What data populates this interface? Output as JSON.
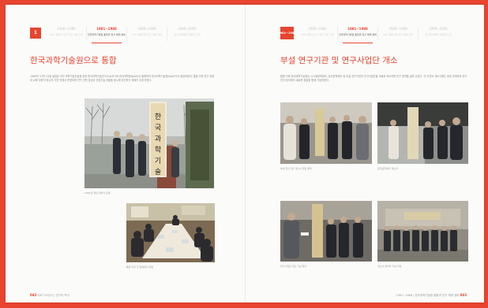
{
  "left_page": {
    "chapter_badge": "1",
    "tabs": [
      {
        "years": "1966~1980",
        "caption": "KIST 설립과 초기 연구 기반 구축"
      },
      {
        "years": "1981~1988",
        "caption": "한국과학기술원 통합과 연구 체제 정비"
      },
      {
        "years": "1989~1998",
        "caption": "KIST 재분리와 연구 역량 강화"
      },
      {
        "years": "1999~2005",
        "caption": "연구회 체제와 새로운 도약"
      }
    ],
    "active_tab": 1,
    "title": "한국과학기술원으로 통합",
    "body": "1980년 12월 23일 설립된 국가 과학기술진흥을 위한 한국과학기술연구소(KIST)와 한국과학원(KAIS)이 통합하여 한국과학기술원(KAIST)이 출범하였다. 통합 이후 연구 부문과 교육 부문이 하나의 기관 안에서 운영되며 연구 인력 양성과 산업기술 개발을 동시에 추진하는 체제가 갖추어졌다.",
    "photo_captions": [
      "1981년 현판 제막식 장면",
      "통합 이후 첫 운영회의 장면"
    ],
    "signboard_text": "한국과학기술원",
    "footer_page": "042",
    "footer_text": "KIST 50년사 | 연구의 역사"
  },
  "right_page": {
    "chapter_badge": "1981~1988",
    "tabs": [
      {
        "years": "1966~1980",
        "caption": "KIST 설립과 초기 연구 기반 구축"
      },
      {
        "years": "1981~1988",
        "caption": "한국과학기술원 통합과 연구 체제 정비"
      },
      {
        "years": "1989~1998",
        "caption": "KIST 재분리와 연구 역량 강화"
      },
      {
        "years": "1999~2005",
        "caption": "연구회 체제와 새로운 도약"
      }
    ],
    "active_tab": 1,
    "title": "부설 연구기관 및 연구사업단 개소",
    "body": "통합 이후 한국과학기술원은 시스템공학센터, 유전공학센터 등 부설 연구기관과 연구사업단을 차례로 개소하며 연구 영역을 넓혀 나갔다. 각 기관의 개소식에는 정부 관계자와 연구진이 참석하여 새로운 출발을 함께 기념하였다.",
    "photo_captions": [
      "부설 연구기관 개소식 현판 제막",
      "유전공학센터 개소식",
      "연구사업단 개소 기념 행사",
      "개소식 참석자 기념 촬영"
    ],
    "footer_page": "043",
    "footer_text": "1981~1988 | 한국과학기술원 통합과 연구 체제 정비"
  },
  "colors": {
    "accent": "#e8442f",
    "page": "#fbfbfa",
    "background": "#e8442f"
  }
}
